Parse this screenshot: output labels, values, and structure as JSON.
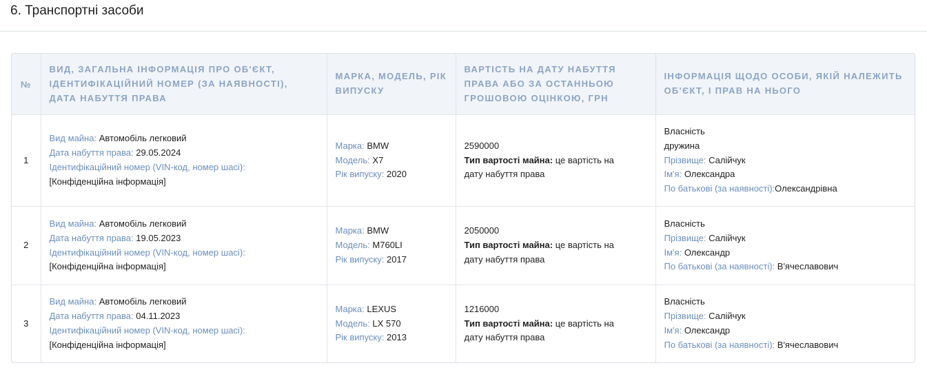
{
  "section": {
    "title": "6. Транспортні засоби"
  },
  "table": {
    "headers": {
      "num": "№",
      "object": "Вид, загальна інформація про об'єкт, ідентифікаційний номер (за наявності), дата набуття права",
      "brand": "Марка, модель, рік випуску",
      "value": "Вартість на дату набуття права або за останньою грошовою оцінкою, грн",
      "owner": "Інформація щодо особи, якій належить об'єкт, і прав на нього"
    },
    "labels": {
      "property_type": "Вид майна:",
      "acquisition_date": "Дата набуття права:",
      "vin": "Ідентифікаційний номер (VIN-код, номер шасі):",
      "brand": "Марка:",
      "model": "Модель:",
      "year": "Рік випуску:",
      "value_type": "Тип вартості майна:",
      "surname": "Прізвище:",
      "name": "Ім'я:",
      "patronymic": "По батькові (за наявності):"
    },
    "rows": [
      {
        "num": "1",
        "property_type": "Автомобіль легковий",
        "acquisition_date": "29.05.2024",
        "vin": "[Конфіденційна інформація]",
        "brand": "BMW",
        "model": "X7",
        "year": "2020",
        "value": "2590000",
        "value_type_1": "це вартість на",
        "value_type_2": "дату набуття права",
        "right": "Власність",
        "relation": "дружина",
        "surname": "Салійчук",
        "name": "Олександра",
        "patronymic": "Олександрівна"
      },
      {
        "num": "2",
        "property_type": "Автомобіль легковий",
        "acquisition_date": "19.05.2023",
        "vin": "[Конфіденційна інформація]",
        "brand": "BMW",
        "model": "M760LI",
        "year": "2017",
        "value": "2050000",
        "value_type_1": "це вартість на",
        "value_type_2": "дату набуття права",
        "right": "Власність",
        "surname": "Салійчук",
        "name": "Олександр",
        "patronymic": "В'ячеславович"
      },
      {
        "num": "3",
        "property_type": "Автомобіль легковий",
        "acquisition_date": "04.11.2023",
        "vin": "[Конфіденційна інформація]",
        "brand": "LEXUS",
        "model": "LX 570",
        "year": "2013",
        "value": "1216000",
        "value_type_1": "це вартість на",
        "value_type_2": "дату набуття права",
        "right": "Власність",
        "surname": "Салійчук",
        "name": "Олександр",
        "patronymic": "В'ячеславович"
      }
    ]
  }
}
